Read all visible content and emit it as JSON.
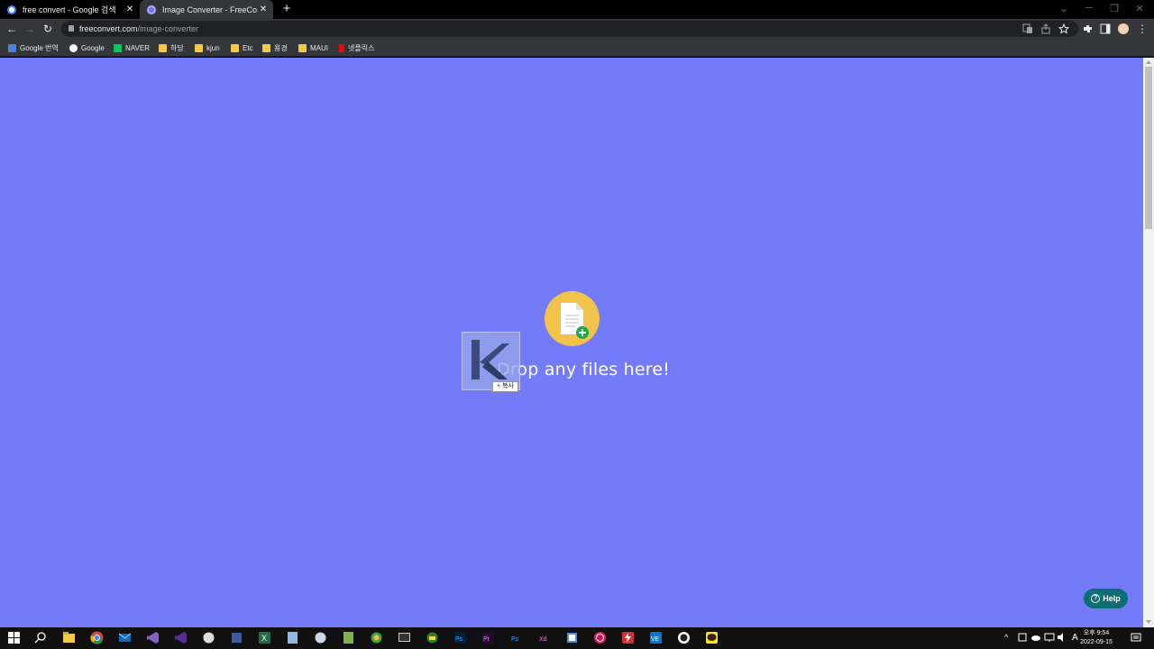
{
  "browser": {
    "tabs": [
      {
        "title": "free convert - Google 검색",
        "active": false,
        "favicon_icon": "google-icon"
      },
      {
        "title": "Image Converter - FreeConvert",
        "active": true,
        "favicon_icon": "freeconvert-icon"
      }
    ],
    "new_tab_label": "+",
    "close_label": "✕",
    "address": {
      "domain": "freeconvert.com",
      "path": "/image-converter"
    },
    "bookmarks": [
      {
        "label": "Google 번역",
        "icon": "google-translate-icon"
      },
      {
        "label": "Google",
        "icon": "google-icon"
      },
      {
        "label": "NAVER",
        "icon": "naver-icon"
      },
      {
        "label": "하당",
        "icon": "folder-icon"
      },
      {
        "label": "kjun",
        "icon": "folder-icon"
      },
      {
        "label": "Etc",
        "icon": "folder-icon"
      },
      {
        "label": "용경",
        "icon": "folder-icon"
      },
      {
        "label": "MAUI",
        "icon": "folder-icon"
      },
      {
        "label": "넷플릭스",
        "icon": "netflix-icon"
      }
    ]
  },
  "page": {
    "background": "#737bf8",
    "drop_text": "Drop any files here!",
    "drop_icon": "file-add-icon",
    "drag_badge": "+ 복사",
    "help_label": "Help"
  },
  "taskbar": {
    "clock_time": "오후 9:54",
    "clock_date": "2022-09-15",
    "ime_label": "A",
    "apps": [
      "start-icon",
      "search-icon",
      "file-explorer-icon",
      "chrome-icon",
      "mail-icon",
      "visual-studio-icon",
      "visual-studio-preview-icon",
      "app-icon",
      "app-icon",
      "excel-icon",
      "app-icon",
      "app-icon",
      "app-icon",
      "app-icon",
      "terminal-icon",
      "app-icon",
      "photoshop-icon",
      "premiere-icon",
      "photoshop-icon",
      "xd-icon",
      "app-icon",
      "record-icon",
      "app-icon",
      "vscode-icon",
      "app-icon",
      "kakaotalk-icon"
    ]
  }
}
